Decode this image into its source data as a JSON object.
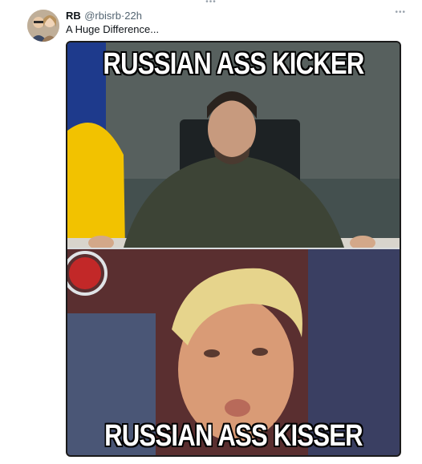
{
  "tweet": {
    "author_name": "RB",
    "handle": "@rbisrb",
    "separator": "·",
    "time": "22h",
    "text": "A Huge Difference..."
  },
  "meme": {
    "top_caption": "RUSSIAN ASS KICKER",
    "bottom_caption": "RUSSIAN ASS KISSER"
  },
  "icons": {
    "top_dots": "more-dots-icon",
    "more": "more-options-icon"
  },
  "colors": {
    "name": "#0f1419",
    "secondary": "#536471"
  }
}
